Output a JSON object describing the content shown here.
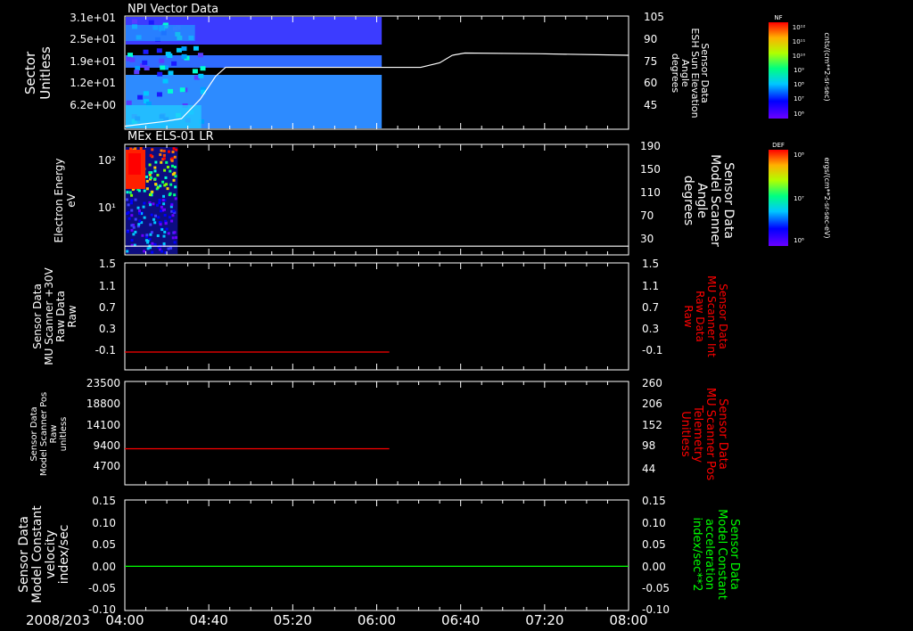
{
  "date_label": "2008/203",
  "x_axis": {
    "tick_labels": [
      "04:00",
      "04:40",
      "05:20",
      "06:00",
      "06:40",
      "07:20",
      "08:00"
    ],
    "range_hours": [
      4.0,
      8.0
    ]
  },
  "colors": {
    "background": "#000000",
    "axis": "#ffffff",
    "red_trace": "#ff0000",
    "green_trace": "#00ff00"
  },
  "chart_data": [
    {
      "type": "heatmap",
      "id": "panel1",
      "title": "NPI Vector Data",
      "ylabel_left": [
        "Sector",
        "Unitless"
      ],
      "left_ticks": [
        "3.1e+01",
        "2.5e+01",
        "1.9e+01",
        "1.2e+01",
        "6.2e+00"
      ],
      "ylabel_right": [
        "Sensor Data",
        "ESH Sun Elevation",
        "Angle",
        "degrees"
      ],
      "right_ticks": [
        "105",
        "90",
        "75",
        "60",
        "45"
      ],
      "right_range": [
        30,
        105
      ],
      "heatmap_end_hours": 6.04,
      "overlay_line": {
        "color": "#ffffff",
        "x": [
          4.0,
          4.3,
          4.45,
          4.6,
          4.72,
          4.8,
          5.5,
          6.2,
          6.35,
          6.5,
          6.6,
          6.7,
          7.3,
          8.0
        ],
        "y": [
          32,
          35,
          37,
          50,
          65,
          71,
          71,
          71,
          71,
          74,
          79,
          80.5,
          80,
          79
        ]
      },
      "colorbar": {
        "label": "NF",
        "unit": "cnts/(cm**2-sr-sec)",
        "tick_labels": [
          "10¹²",
          "10¹¹",
          "10¹⁰",
          "10⁹",
          "10⁸",
          "10⁷",
          "10⁶"
        ]
      }
    },
    {
      "type": "heatmap",
      "id": "panel2",
      "title": "MEx ELS-01 LR",
      "ylabel_left": [
        "Electron Energy",
        "eV"
      ],
      "left_ticks": [
        "10²",
        "10¹"
      ],
      "ylabel_right": [
        "Sensor Data",
        "Model Scanner",
        "Angle",
        "degrees"
      ],
      "right_ticks": [
        "190",
        "150",
        "110",
        "70",
        "30"
      ],
      "right_range": [
        0,
        190
      ],
      "heatmap_end_hours": 4.42,
      "overlay_line": {
        "color": "#ffffff",
        "x": [
          4.0,
          8.0
        ],
        "y": [
          15,
          15
        ]
      },
      "colorbar": {
        "label": "DEF",
        "unit": "ergs/(cm**2-sr-sec-eV)",
        "tick_labels": [
          "10⁸",
          "10⁷",
          "10⁶"
        ]
      }
    },
    {
      "type": "line",
      "id": "panel3",
      "ylabel_left": [
        "Sensor Data",
        "MU Scanner +30V",
        "Raw Data",
        "Raw"
      ],
      "left_ticks": [
        "1.5",
        "1.1",
        "0.7",
        "0.3",
        "-0.1"
      ],
      "ylim": [
        -0.3,
        1.5
      ],
      "ylabel_right": [
        "Sensor Data",
        "MU Scanner Int",
        "Raw Data",
        "Raw"
      ],
      "right_ticks": [
        "1.5",
        "1.1",
        "0.7",
        "0.3",
        "-0.1"
      ],
      "series": [
        {
          "color": "#ff0000",
          "x": [
            4.0,
            6.1
          ],
          "y": [
            0.0,
            0.0
          ]
        }
      ]
    },
    {
      "type": "line",
      "id": "panel4",
      "ylabel_left": [
        "Sensor Data",
        "Model Scanner Pos",
        "Raw",
        "unitless"
      ],
      "left_ticks": [
        "23500",
        "18800",
        "14100",
        "9400",
        "4700"
      ],
      "ylim": [
        0,
        23500
      ],
      "ylabel_right": [
        "Sensor Data",
        "MU Scanner Pos",
        "Telemetry",
        "Unitless"
      ],
      "right_ticks": [
        "260",
        "206",
        "152",
        "98",
        "44"
      ],
      "series": [
        {
          "color": "#ff0000",
          "x": [
            4.0,
            6.1
          ],
          "y": [
            8200,
            8200
          ]
        }
      ]
    },
    {
      "type": "line",
      "id": "panel5",
      "ylabel_left": [
        "Sensor Data",
        "Model Constant",
        "velocity",
        "index/sec"
      ],
      "left_ticks": [
        "0.15",
        "0.10",
        "0.05",
        "0.00",
        "-0.05",
        "-0.10"
      ],
      "ylim": [
        -0.1,
        0.15
      ],
      "ylabel_right": [
        "Sensor Data",
        "Model Constant",
        "acceleration",
        "index/sec**2"
      ],
      "right_ticks": [
        "0.15",
        "0.10",
        "0.05",
        "0.00",
        "-0.05",
        "-0.10"
      ],
      "series": [
        {
          "color": "#00ff00",
          "x": [
            4.0,
            8.0
          ],
          "y": [
            0.0,
            0.0
          ]
        }
      ]
    }
  ]
}
